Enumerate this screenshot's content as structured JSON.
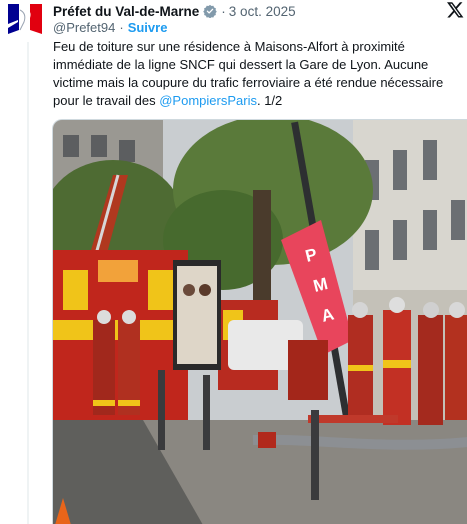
{
  "tweet": {
    "author_name": "Préfet du Val-de-Marne",
    "handle": "@Prefet94",
    "separator": "·",
    "date": "3 oct. 2025",
    "follow_label": "Suivre",
    "text_part1": "Feu de toiture sur une résidence à Maisons-Alfort à proximité immédiate de la ligne SNCF qui dessert la Gare de Lyon. Aucune victime mais la coupure du trafic ferroviaire a été rendue nécessaire pour le travail des ",
    "mention": "@PompiersParis",
    "text_part2": ". 1/2",
    "verified_color": "#829aab",
    "link_color": "#1d9bf0"
  },
  "icons": {
    "avatar": "marianne-logo",
    "verified": "verified-badge-icon",
    "platform": "x-logo-icon"
  },
  "media": {
    "banner_text": "PMA",
    "description_icon": "photo"
  }
}
